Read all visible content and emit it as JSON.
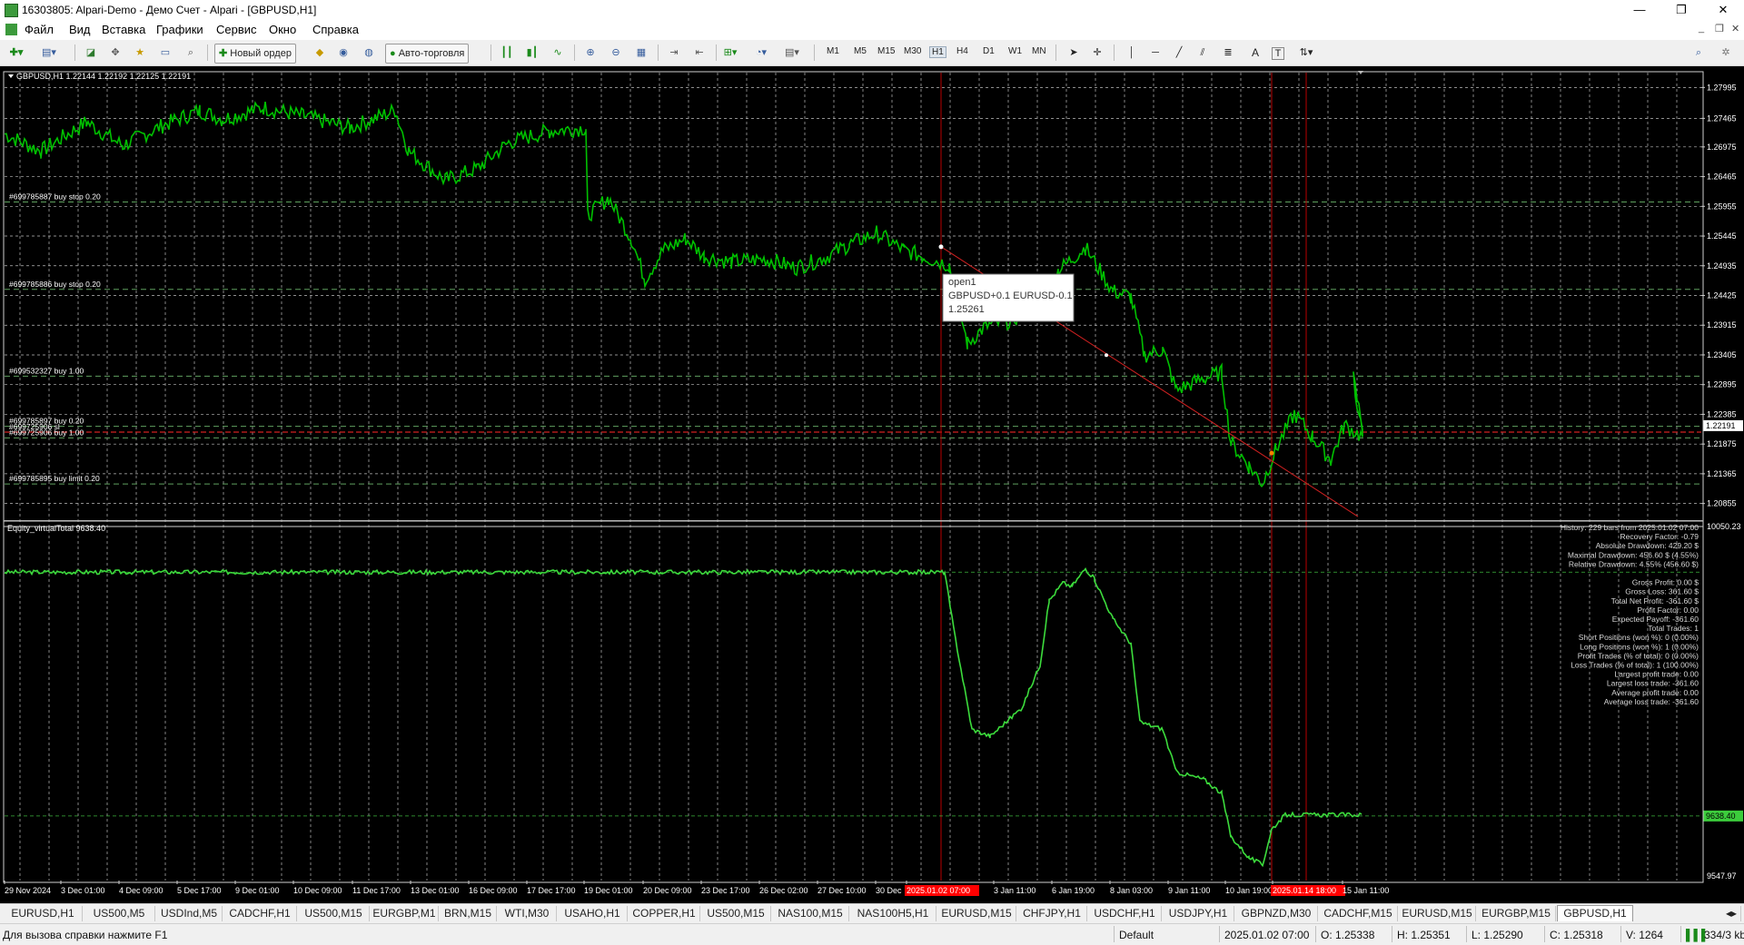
{
  "window": {
    "title": "16303805: Alpari-Demo - Демо Счет - Alpari - [GBPUSD,H1]",
    "minimize": "—",
    "restore": "❐",
    "close": "✕"
  },
  "menu": [
    "Файл",
    "Вид",
    "Вставка",
    "Графики",
    "Сервис",
    "Окно",
    "Справка"
  ],
  "mdi_controls": [
    "_",
    "❐",
    "✕"
  ],
  "toolbar": {
    "new_order_label": "Новый ордер",
    "autotrading_label": "Авто-торговля",
    "timeframes": [
      "M1",
      "M5",
      "M15",
      "M30",
      "H1",
      "H4",
      "D1",
      "W1",
      "MN"
    ],
    "active_timeframe": "H1",
    "text_tool": "A",
    "label_tool": "T"
  },
  "chart": {
    "header": "GBPUSD,H1  1.22144 1.22192 1.22125 1.22191",
    "y_ticks": [
      "1.27995",
      "1.27465",
      "1.26975",
      "1.26465",
      "1.25955",
      "1.25445",
      "1.24935",
      "1.24425",
      "1.23915",
      "1.23405",
      "1.22895",
      "1.22385",
      "1.21875",
      "1.21365",
      "1.20855"
    ],
    "current_price": "1.22191",
    "order_lines": [
      {
        "label": "#699785887 buy stop 0.20",
        "price": 1.2603
      },
      {
        "label": "#699785886 buy stop 0.20",
        "price": 1.2453
      },
      {
        "label": "#699532327 buy 1.00",
        "price": 1.2304
      },
      {
        "label": "#699785897 buy 0.20",
        "price": 1.2218
      },
      {
        "label": "#699725906 sl",
        "price": 1.2208
      },
      {
        "label": "#699725906 buy 1.00",
        "price": 1.2198
      },
      {
        "label": "#699785895 buy limit 0.20",
        "price": 1.2119
      }
    ],
    "tooltip": {
      "line1": "open1",
      "line2": "GBPUSD+0.1 EURUSD-0.1",
      "line3": "1.25261"
    }
  },
  "indicator": {
    "header": "Equity_virtualTotal 9638.40",
    "y_top": "10050.23",
    "y_bottom": "9547.97",
    "current_value": "9638.40",
    "stats": [
      "History: 229 bars from 2025.01.02 07:00",
      "Recovery Factor: -0.79",
      "Absolute Drawdown: 429.20 $",
      "Maximal Drawdown: 456.60 $ (4.55%)",
      "Relative Drawdown: 4.55% (456.60 $)",
      "",
      "Gross Profit: 0.00 $",
      "Gross Loss: 361.60 $",
      "Total Net Profit: -361.60 $",
      "Profit Factor: 0.00",
      "Expected Payoff: -361.60",
      "Total Trades: 1",
      "Short Positions (won %): 0 (0.00%)",
      "Long Positions (won %): 1 (0.00%)",
      "Profit Trades (% of total): 0 (0.00%)",
      "Loss Trades (% of total): 1 (100.00%)",
      "Largest profit trade: 0.00",
      "Largest loss trade: -361.60",
      "Average profit trade: 0.00",
      "Average loss trade: -361.60"
    ]
  },
  "x_axis": [
    "29 Nov 2024",
    "3 Dec 01:00",
    "4 Dec 09:00",
    "5 Dec 17:00",
    "9 Dec 01:00",
    "10 Dec 09:00",
    "11 Dec 17:00",
    "13 Dec 01:00",
    "16 Dec 09:00",
    "17 Dec 17:00",
    "19 Dec 01:00",
    "20 Dec 09:00",
    "23 Dec 17:00",
    "26 Dec 02:00",
    "27 Dec 10:00",
    "30 Dec",
    "2025.01.02 07:00",
    "3 Jan 11:00",
    "6 Jan 19:00",
    "8 Jan 03:00",
    "9 Jan 11:00",
    "10 Jan 19:00",
    "2025.01.14 18:00",
    "15 Jan 11:00"
  ],
  "tabs": [
    "EURUSD,H1",
    "US500,M5",
    "USDInd,M5",
    "CADCHF,H1",
    "US500,M15",
    "EURGBP,M1",
    "BRN,M15",
    "WTI,M30",
    "USAHO,H1",
    "COPPER,H1",
    "US500,M15",
    "NAS100,M15",
    "NAS100H5,H1",
    "EURUSD,M15",
    "CHFJPY,H1",
    "USDCHF,H1",
    "USDJPY,H1",
    "GBPNZD,M30",
    "CADCHF,M15",
    "EURUSD,M15",
    "EURGBP,M15",
    "GBPUSD,H1"
  ],
  "active_tab": "GBPUSD,H1",
  "status": {
    "help": "Для вызова справки нажмите F1",
    "profile": "Default",
    "datetime": "2025.01.02 07:00",
    "open": "O: 1.25338",
    "high": "H: 1.25351",
    "low": "L: 1.25290",
    "close": "C: 1.25318",
    "volume": "V: 1264",
    "traffic": "334/3 kb"
  },
  "colors": {
    "bars": "#00c000",
    "grid": "#c8c8c8",
    "order_line": "#5fa05f",
    "vline": "#b80000",
    "trend": "#d02020",
    "tag_red": "#ff0000"
  }
}
